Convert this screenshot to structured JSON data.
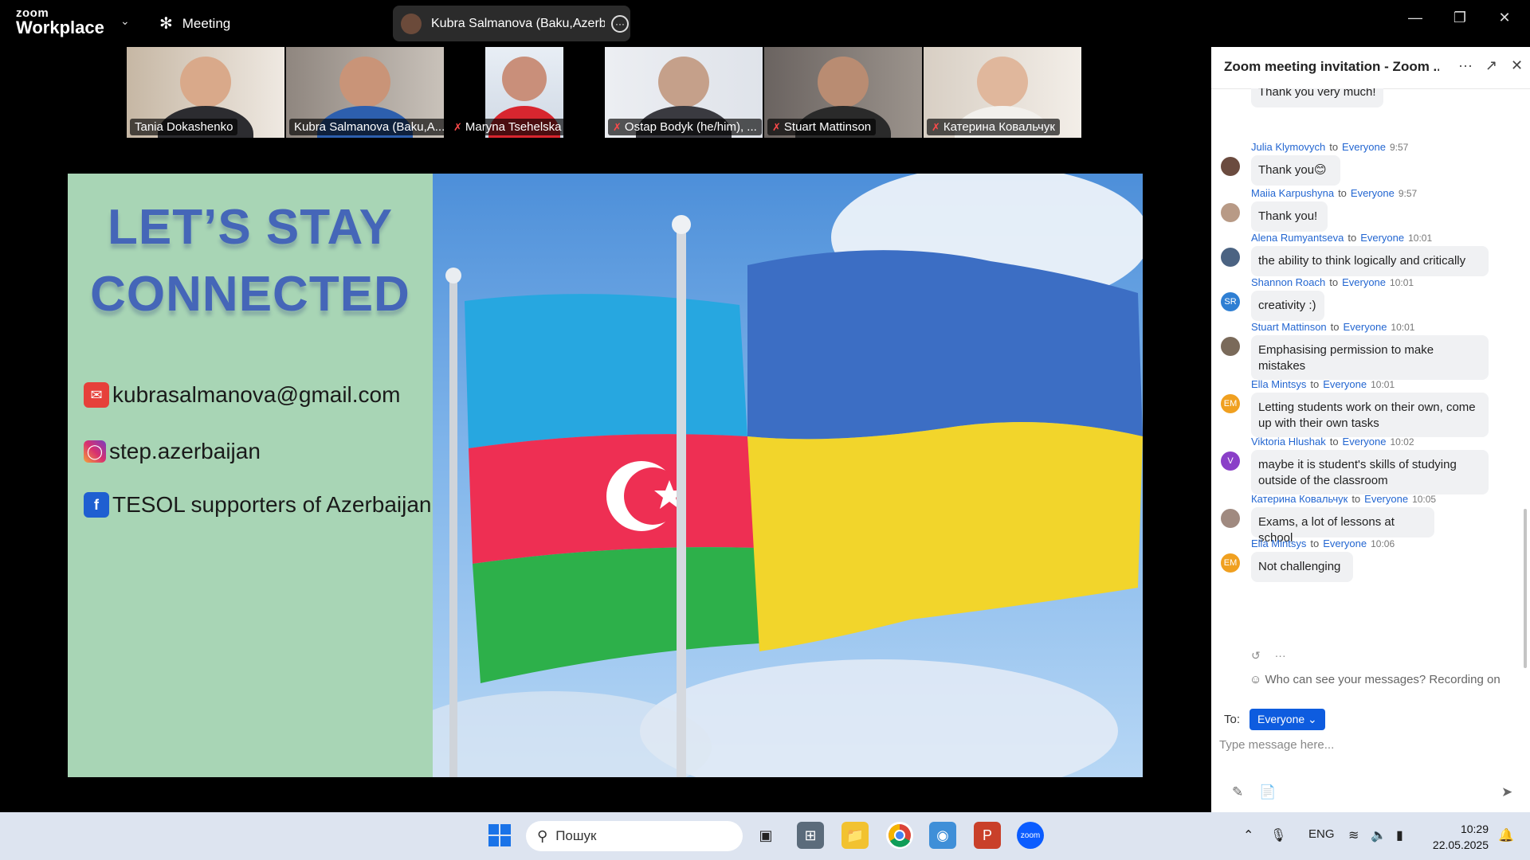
{
  "app": {
    "logo_line1": "zoom",
    "logo_line2": "Workplace",
    "meeting_label": "Meeting",
    "active_speaker": "Kubra Salmanova (Baku,Azerbaija",
    "window_controls": [
      "minimize-icon",
      "restore-icon",
      "close-icon"
    ]
  },
  "participants": [
    {
      "name": "Tania Dokashenko",
      "muted": false,
      "active": false
    },
    {
      "name": "Kubra Salmanova (Baku,A...",
      "muted": false,
      "active": true
    },
    {
      "name": "Maryna Tsehelska",
      "muted": true,
      "active": false
    },
    {
      "name": "Ostap Bodyk (he/him), ...",
      "muted": true,
      "active": false
    },
    {
      "name": "Stuart Mattinson",
      "muted": true,
      "active": false
    },
    {
      "name": "Катерина Ковальчук",
      "muted": true,
      "active": false
    }
  ],
  "slide": {
    "title_line1": "LET’S STAY",
    "title_line2": "CONNECTED",
    "email": "kubrasalmanova@gmail.com",
    "instagram": "step.azerbaijan",
    "facebook": "TESOL supporters of Azerbaijan"
  },
  "chat": {
    "title": "Zoom meeting invitation - Zoom ...",
    "partial_top": "Thank you very much!",
    "messages": [
      {
        "sender": "Julia Klymovych",
        "to": "Everyone",
        "time": "9:57",
        "text": "Thank you😊",
        "initials": "",
        "avatar_color": "#6b4b3f"
      },
      {
        "sender": "Maiia Karpushyna",
        "to": "Everyone",
        "time": "9:57",
        "text": "Thank you!",
        "initials": "",
        "avatar_color": "#b89a86"
      },
      {
        "sender": "Alena Rumyantseva",
        "to": "Everyone",
        "time": "10:01",
        "text": "the ability to think logically and critically",
        "initials": "",
        "avatar_color": "#4b6382"
      },
      {
        "sender": "Shannon Roach",
        "to": "Everyone",
        "time": "10:01",
        "text": "creativity :)",
        "initials": "SR",
        "avatar_color": "#2f7fd3"
      },
      {
        "sender": "Stuart Mattinson",
        "to": "Everyone",
        "time": "10:01",
        "text": "Emphasising permission to make mistakes",
        "initials": "",
        "avatar_color": "#7a6a5a"
      },
      {
        "sender": "Ella Mintsys",
        "to": "Everyone",
        "time": "10:01",
        "text": "Letting students work on their own, come up with their own tasks",
        "initials": "EM",
        "avatar_color": "#f0a020"
      },
      {
        "sender": "Viktoria Hlushak",
        "to": "Everyone",
        "time": "10:02",
        "text": "maybe it is student's skills of studying outside of the classroom",
        "initials": "V",
        "avatar_color": "#8a3fc8"
      },
      {
        "sender": "Катерина Ковальчук",
        "to": "Everyone",
        "time": "10:05",
        "text": "Exams, a lot of lessons at school",
        "initials": "",
        "avatar_color": "#a08a80"
      },
      {
        "sender": "Ella Mintsys",
        "to": "Everyone",
        "time": "10:06",
        "text": "Not challenging",
        "initials": "EM",
        "avatar_color": "#f0a020"
      }
    ],
    "to_word": "to",
    "visibility_text": "Who can see your messages? Recording on",
    "to_label": "To:",
    "recipient": "Everyone",
    "input_placeholder": "Type message here..."
  },
  "taskbar": {
    "search_placeholder": "Пошук",
    "language": "ENG",
    "time": "10:29",
    "date": "22.05.2025"
  }
}
